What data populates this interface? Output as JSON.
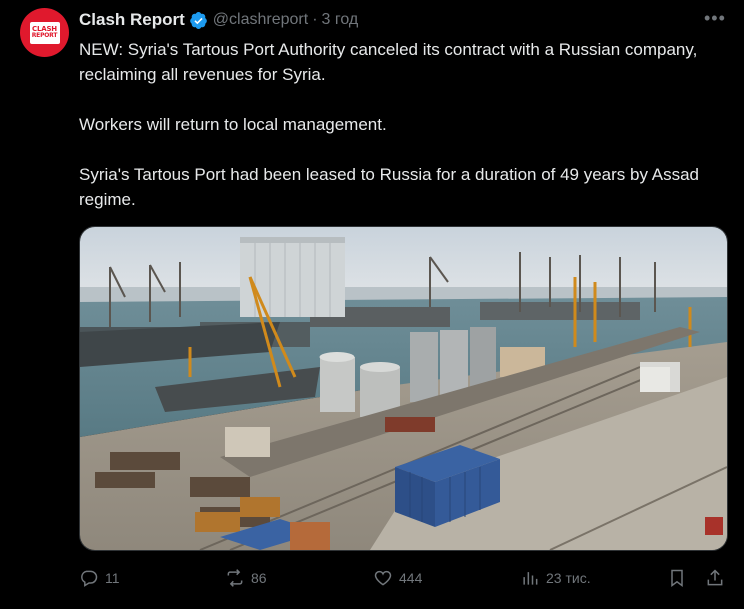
{
  "author": {
    "name": "Clash Report",
    "handle": "@clashreport",
    "separator": "·",
    "time": "3 год",
    "avatar_text_line1": "CLASH",
    "avatar_text_line2": "REPORT",
    "verified": true
  },
  "text": {
    "p1": "NEW: Syria's Tartous Port Authority canceled its contract with a Russian company, reclaiming all revenues for Syria.",
    "p2": "Workers will return to local management.",
    "p3": "Syria's Tartous Port had been leased to Russia for a duration of 49 years by Assad regime."
  },
  "actions": {
    "replies": "11",
    "reposts": "86",
    "likes": "444",
    "views": "23 тис."
  },
  "icons": [
    "verified-badge-icon",
    "more-icon",
    "reply-icon",
    "repost-icon",
    "like-icon",
    "views-icon",
    "bookmark-icon",
    "share-icon"
  ],
  "colors": {
    "accent": "#1d9bf0",
    "muted": "#71767b",
    "text": "#e7e9ea",
    "background": "#000000",
    "avatar": "#e0192d"
  }
}
